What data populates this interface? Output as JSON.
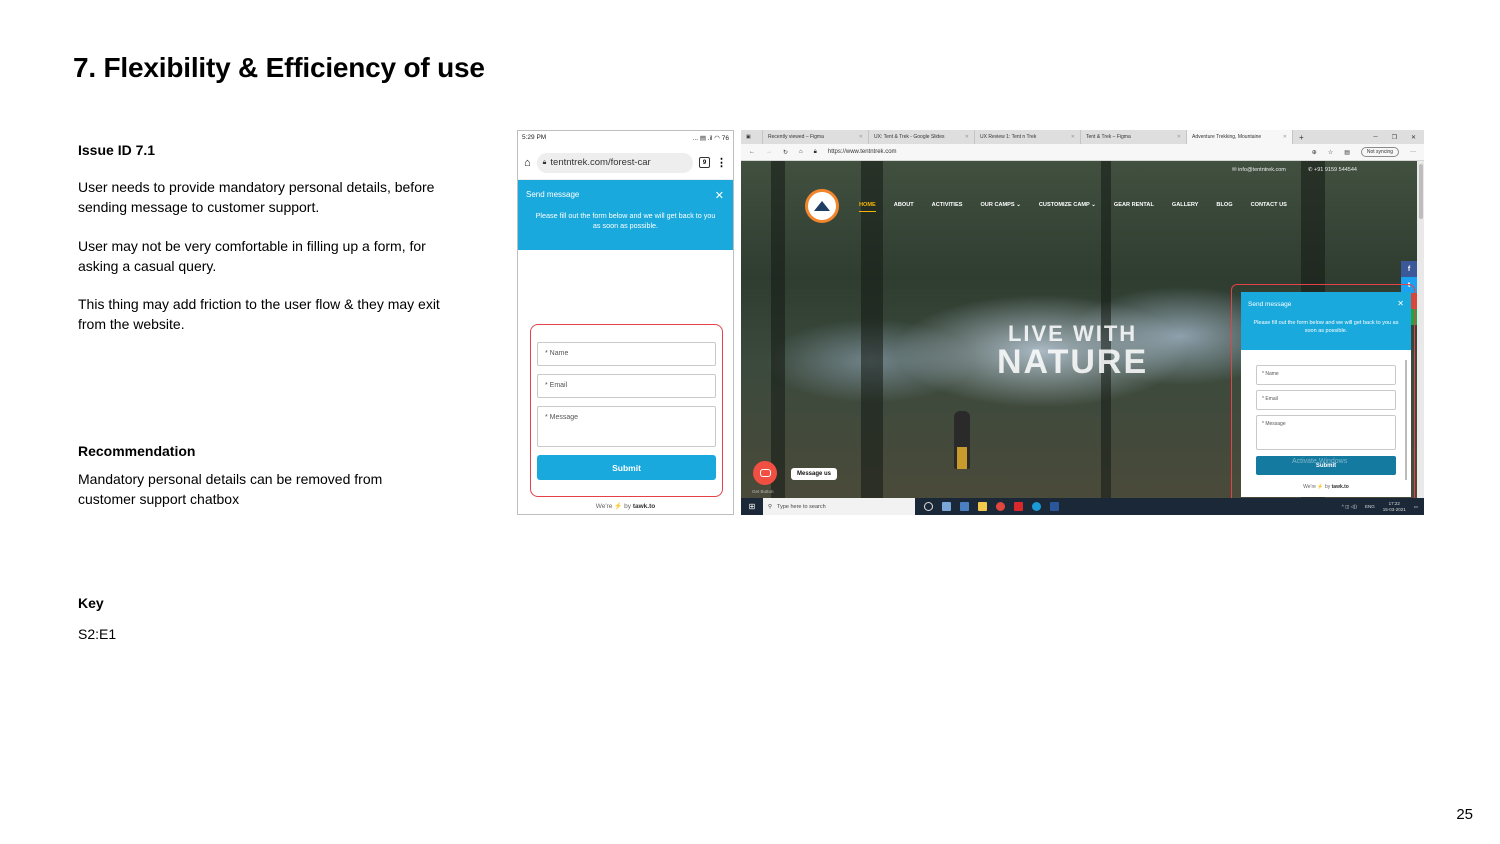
{
  "slide": {
    "title": "7. Flexibility & Efficiency of use",
    "issue_id": "Issue ID 7.1",
    "issue_paragraphs": [
      "User needs to provide mandatory  personal details, before sending message to customer support.",
      "User may not be very comfortable in filling up a form, for asking a casual query.",
      "This thing may add friction to the user flow & they may exit from the website."
    ],
    "recommendation_heading": "Recommendation",
    "recommendation_text": "Mandatory personal details can be removed from customer support chatbox",
    "key_heading": "Key",
    "key_value": "S2:E1",
    "page_number": "25"
  },
  "phone": {
    "time": "5:29 PM",
    "status_icons": "... ▤ .il ◠ 76",
    "url": "tentntrek.com/forest-car",
    "tab_count": "9",
    "widget_title": "Send message",
    "widget_subtitle": "Please fill out the form below and we will get back to you as soon as possible.",
    "fields": [
      "* Name",
      "* Email",
      "* Message"
    ],
    "submit": "Submit",
    "footer_prefix": "We're",
    "footer_by": "by",
    "footer_brand": "tawk.to"
  },
  "desktop": {
    "tabs": [
      {
        "label": "Recently viewed – Figma",
        "active": false
      },
      {
        "label": "UX: Tent & Trek - Google Slides",
        "active": false
      },
      {
        "label": "UX Review 1: Tent n Trek",
        "active": false
      },
      {
        "label": "Tent & Trek – Figma",
        "active": false
      },
      {
        "label": "Adventure Trekking, Mountaine",
        "active": true
      }
    ],
    "url": "https://www.tentntrek.com",
    "not_syncing": "Not syncing",
    "site_email": "✉ info@tentntrek.com",
    "site_phone": "✆ +91 9159 544544",
    "nav": [
      "HOME",
      "ABOUT",
      "ACTIVITIES",
      "OUR CAMPS ⌄",
      "CUSTOMIZE CAMP ⌄",
      "GEAR RENTAL",
      "GALLERY",
      "BLOG",
      "CONTACT US"
    ],
    "hero_line1": "LIVE WITH",
    "hero_line2": "NATURE",
    "chat_pill": "Message us",
    "cookie_text": "Get Button",
    "widget_title": "Send message",
    "widget_subtitle": "Please fill out the form below and we will get back to you as soon as possible.",
    "fields": [
      "* Name",
      "* Email",
      "* Message"
    ],
    "submit": "Submit",
    "activate_overlay": "Activate Windows",
    "footer_prefix": "We're",
    "footer_by": "by",
    "footer_brand": "tawk.to",
    "taskbar_search": "Type here to search",
    "tray_time": "17:22",
    "tray_date": "15-03-2021",
    "tray_lang": "ENG",
    "colors": {
      "accent": "#1aa9dc",
      "highlight": "#e34248",
      "nav_active": "#f5b400"
    }
  }
}
